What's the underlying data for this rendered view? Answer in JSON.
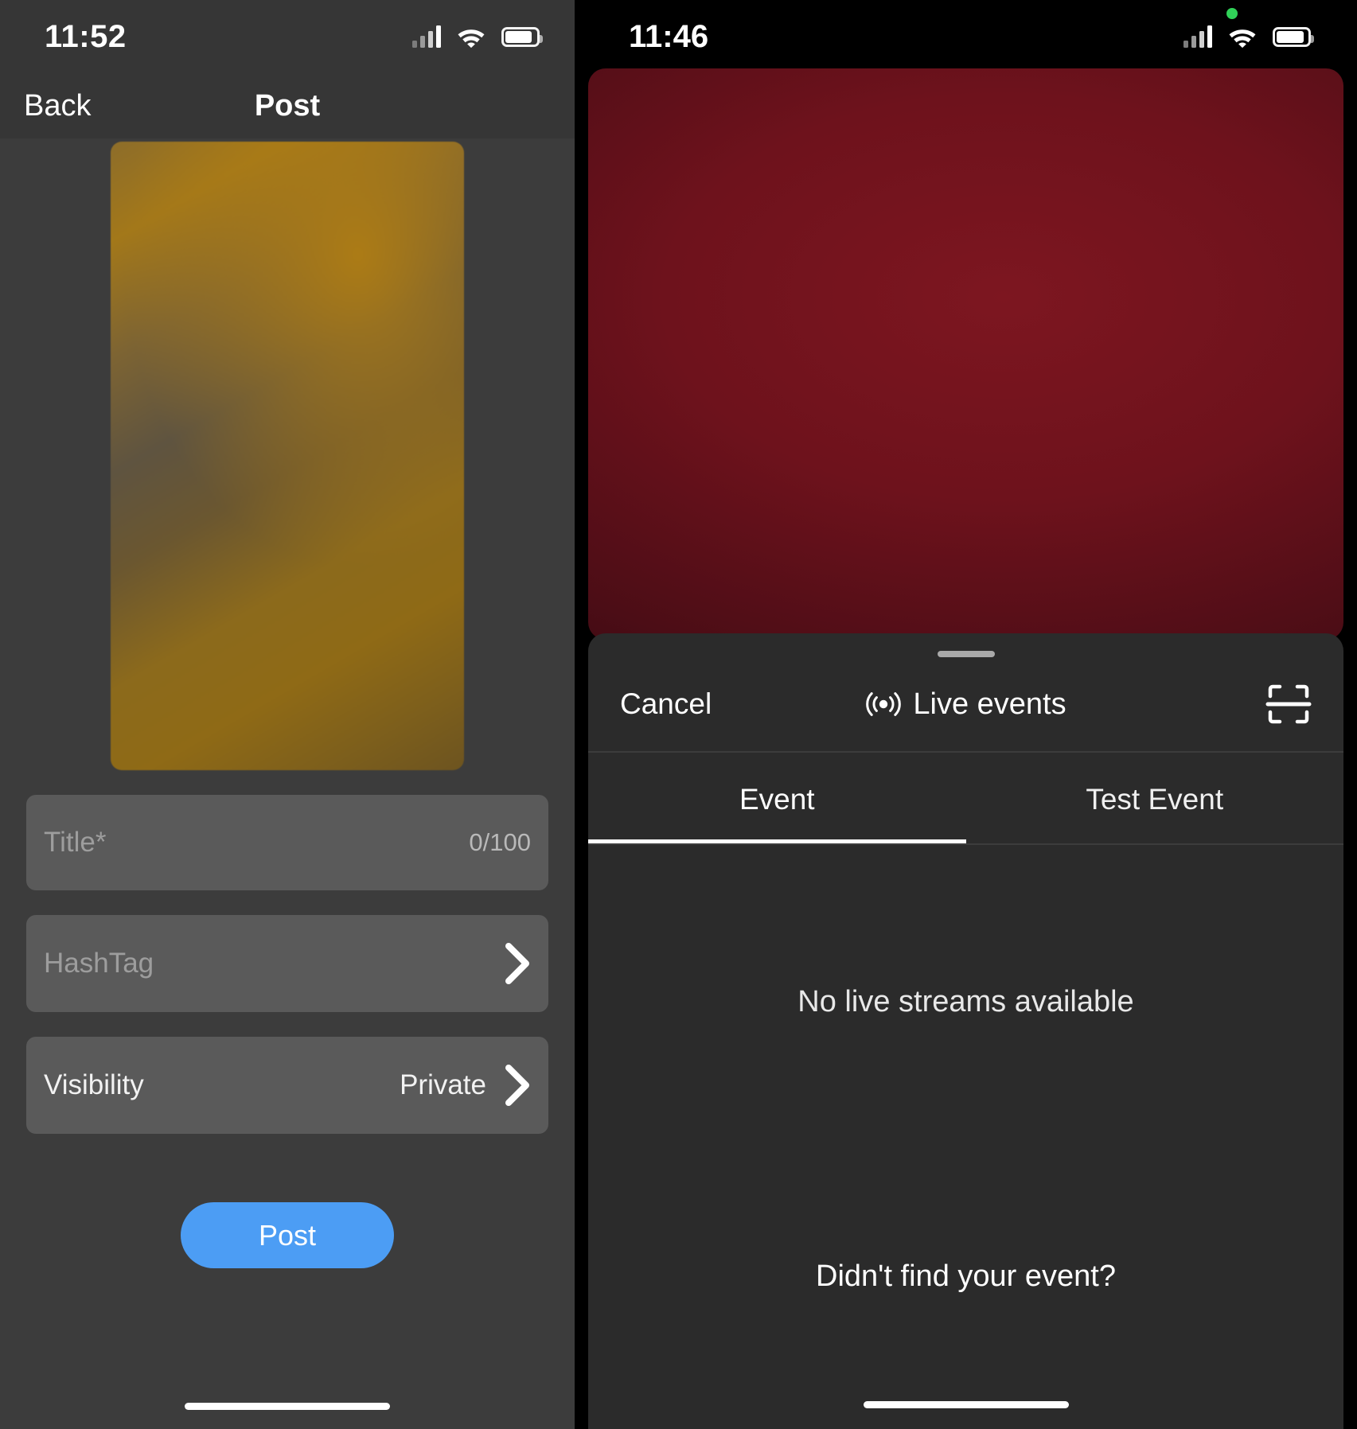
{
  "left_phone": {
    "status_bar": {
      "time": "11:52",
      "icons": [
        "cellular-signal-icon",
        "wifi-icon",
        "battery-icon"
      ]
    },
    "nav": {
      "back_label": "Back",
      "title": "Post"
    },
    "media": {
      "name": "video-thumbnail-preview"
    },
    "form": {
      "title_field": {
        "placeholder": "Title*",
        "value": "",
        "counter": "0/100"
      },
      "hashtag_field": {
        "placeholder": "HashTag",
        "value": "",
        "chevron": "chevron-right-icon"
      },
      "visibility_field": {
        "label": "Visibility",
        "value": "Private",
        "chevron": "chevron-right-icon"
      }
    },
    "post_button": {
      "label": "Post",
      "color": "#4c9df4"
    }
  },
  "right_phone": {
    "status_bar": {
      "time": "11:46",
      "recording_dot_color": "#30d158",
      "icons": [
        "cellular-signal-icon",
        "wifi-icon",
        "battery-icon"
      ]
    },
    "video_preview": {
      "name": "live-camera-preview",
      "dominant_color": "#6e121c"
    },
    "sheet": {
      "cancel_label": "Cancel",
      "title": "Live events",
      "title_icon": "broadcast-icon",
      "scan_icon": "scan-barcode-icon",
      "tabs": [
        {
          "label": "Event",
          "active": true
        },
        {
          "label": "Test Event",
          "active": false
        }
      ],
      "empty_state": "No live streams available",
      "footer_link": "Didn't find your event?"
    }
  }
}
